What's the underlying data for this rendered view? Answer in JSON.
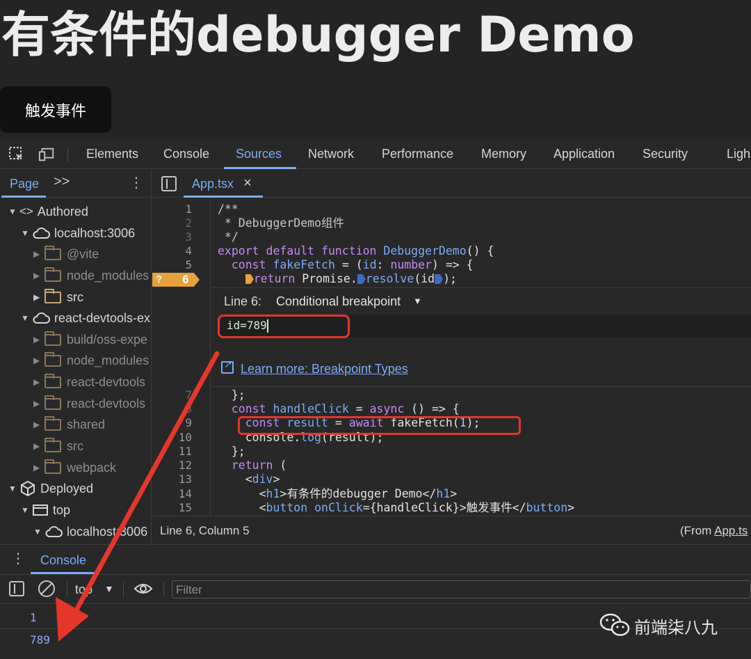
{
  "page": {
    "heading": "有条件的debugger Demo",
    "button_label": "触发事件"
  },
  "devtools": {
    "tabs": [
      "Elements",
      "Console",
      "Sources",
      "Network",
      "Performance",
      "Memory",
      "Application",
      "Security",
      "Ligh"
    ],
    "active_tab": "Sources",
    "navigator": {
      "tab_label": "Page",
      "more_label": ">>",
      "tree": [
        {
          "label": "Authored",
          "icon": "code-icon"
        },
        {
          "label": "localhost:3006",
          "icon": "cloud-icon"
        },
        {
          "label": "@vite",
          "icon": "folder-icon"
        },
        {
          "label": "node_modules",
          "icon": "folder-icon"
        },
        {
          "label": "src",
          "icon": "folder-icon"
        },
        {
          "label": "react-devtools-ex",
          "icon": "cloud-icon"
        },
        {
          "label": "build/oss-expe",
          "icon": "folder-icon"
        },
        {
          "label": "node_modules",
          "icon": "folder-icon"
        },
        {
          "label": "react-devtools",
          "icon": "folder-icon"
        },
        {
          "label": "react-devtools",
          "icon": "folder-icon"
        },
        {
          "label": "shared",
          "icon": "folder-icon"
        },
        {
          "label": "src",
          "icon": "folder-icon"
        },
        {
          "label": "webpack",
          "icon": "folder-icon"
        },
        {
          "label": "Deployed",
          "icon": "cube-icon"
        },
        {
          "label": "top",
          "icon": "frame-icon"
        },
        {
          "label": "localhost:3006",
          "icon": "cloud-icon"
        }
      ]
    },
    "editor": {
      "file_tab": "App.tsx",
      "close_label": "×",
      "line_numbers_top": [
        "1",
        "2",
        "3",
        "4",
        "5",
        "6"
      ],
      "line_numbers_bottom": [
        "7",
        "8",
        "9",
        "10",
        "11",
        "12",
        "13",
        "14",
        "15"
      ],
      "breakpoint": {
        "line_label": "Line 6:",
        "type_label": "Conditional breakpoint",
        "condition": "id=789",
        "learn_more": "Learn more: Breakpoint Types",
        "marker_symbol": "?",
        "marker_line": "6"
      },
      "status_position": "Line 6, Column 5",
      "status_from_prefix": "(From ",
      "status_from_file": "App.ts"
    },
    "drawer": {
      "tab_label": "Console",
      "context_label": "top",
      "filter_placeholder": "Filter",
      "logs": [
        "1",
        "789"
      ]
    }
  },
  "watermark": {
    "text": "前端柒八九",
    "icon": "wechat-icon"
  },
  "colors": {
    "accent": "#7cacf8",
    "annotation_red": "#e5362a",
    "breakpoint": "#e6a23c",
    "keyword": "#c58af9"
  }
}
